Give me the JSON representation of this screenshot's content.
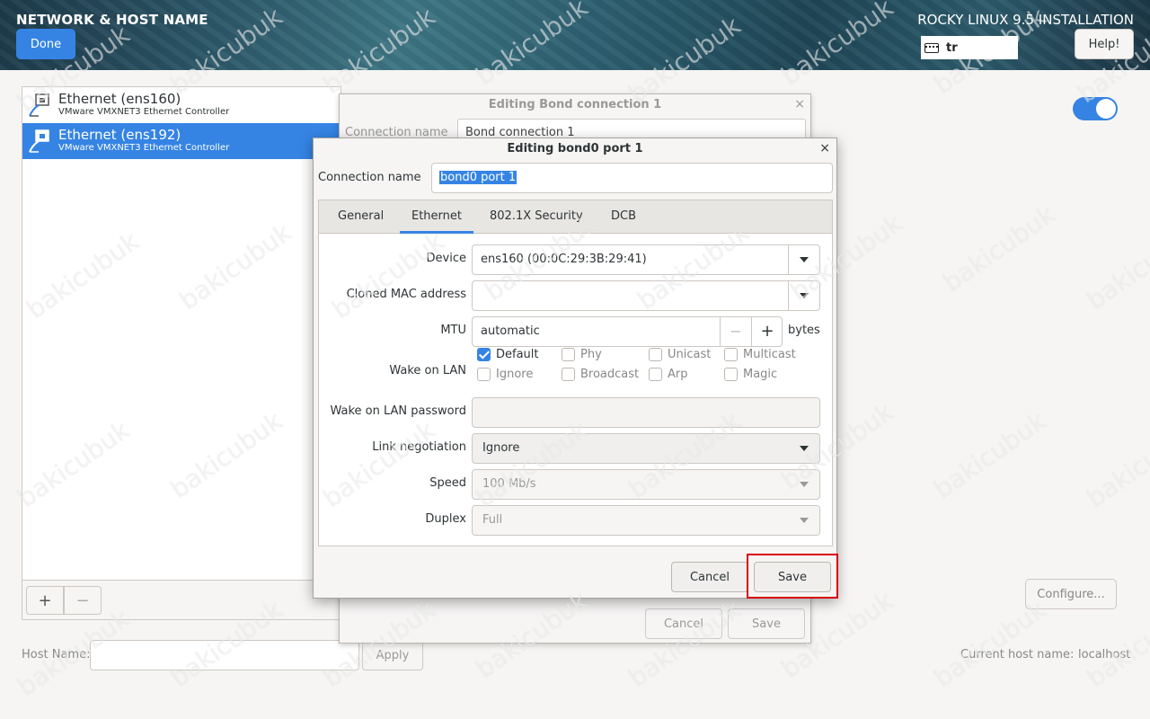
{
  "header": {
    "title": "NETWORK & HOST NAME",
    "done_label": "Done",
    "installer_title": "ROCKY LINUX 9.5 INSTALLATION",
    "keyboard_layout": "tr",
    "help_label": "Help!"
  },
  "devices": [
    {
      "name": "Ethernet (ens160)",
      "description": "VMware VMXNET3 Ethernet Controller",
      "selected": false
    },
    {
      "name": "Ethernet (ens192)",
      "description": "VMware VMXNET3 Ethernet Controller",
      "selected": true
    }
  ],
  "device_toolbar": {
    "add_label": "+",
    "remove_label": "−"
  },
  "ethernet_toggle": {
    "on": true
  },
  "configure_label": "Configure...",
  "hostname": {
    "label": "Host Name:",
    "value": "",
    "apply_label": "Apply",
    "current_label": "Current host name:",
    "current_value": "localhost"
  },
  "bond_dialog": {
    "title": "Editing Bond connection 1",
    "close_glyph": "×",
    "conn_name_label": "Connection name",
    "conn_name_value": "Bond connection 1",
    "cancel_label": "Cancel",
    "save_label": "Save"
  },
  "port_dialog": {
    "title": "Editing bond0 port 1",
    "close_glyph": "×",
    "conn_name_label": "Connection name",
    "conn_name_value": "bond0 port 1",
    "tabs": [
      {
        "label": "General",
        "active": false
      },
      {
        "label": "Ethernet",
        "active": true
      },
      {
        "label": "802.1X Security",
        "active": false
      },
      {
        "label": "DCB",
        "active": false
      }
    ],
    "ethernet": {
      "device_label": "Device",
      "device_value": "ens160 (00:0C:29:3B:29:41)",
      "cloned_mac_label": "Cloned MAC address",
      "cloned_mac_value": "",
      "mtu_label": "MTU",
      "mtu_value": "automatic",
      "mtu_minus": "−",
      "mtu_plus": "+",
      "mtu_unit": "bytes",
      "wol_label": "Wake on LAN",
      "wol_options": [
        {
          "label": "Default",
          "checked": true
        },
        {
          "label": "Phy",
          "checked": false
        },
        {
          "label": "Unicast",
          "checked": false
        },
        {
          "label": "Multicast",
          "checked": false
        },
        {
          "label": "Ignore",
          "checked": false
        },
        {
          "label": "Broadcast",
          "checked": false
        },
        {
          "label": "Arp",
          "checked": false
        },
        {
          "label": "Magic",
          "checked": false
        }
      ],
      "wol_password_label": "Wake on LAN password",
      "wol_password_value": "",
      "link_negotiation_label": "Link negotiation",
      "link_negotiation_value": "Ignore",
      "speed_label": "Speed",
      "speed_value": "100 Mb/s",
      "duplex_label": "Duplex",
      "duplex_value": "Full"
    },
    "cancel_label": "Cancel",
    "save_label": "Save"
  },
  "watermark_text": "bakicubuk",
  "colors": {
    "accent": "#3584e4",
    "highlight": "#d9000f"
  }
}
